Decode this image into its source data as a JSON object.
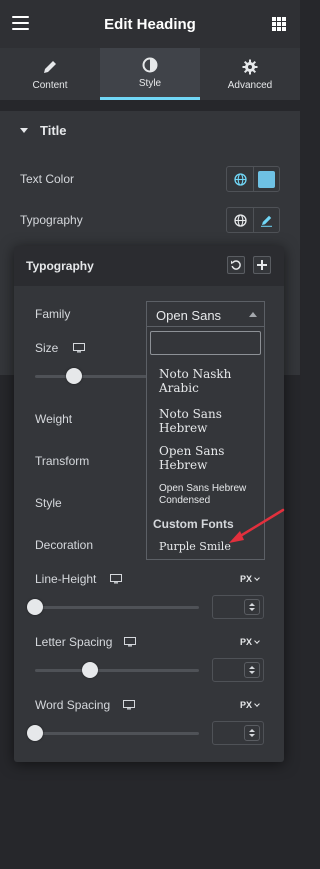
{
  "header": {
    "title": "Edit Heading"
  },
  "tabs": [
    {
      "label": "Content",
      "icon": "pencil-icon"
    },
    {
      "label": "Style",
      "icon": "contrast-icon"
    },
    {
      "label": "Advanced",
      "icon": "gear-icon"
    }
  ],
  "section": {
    "title": "Title"
  },
  "controls": {
    "text_color_label": "Text Color",
    "text_color_value": "#6ec1e4",
    "typography_label": "Typography"
  },
  "popover": {
    "title": "Typography",
    "family_label": "Family",
    "size_label": "Size",
    "weight_label": "Weight",
    "transform_label": "Transform",
    "style_label": "Style",
    "decoration_label": "Decoration",
    "line_height_label": "Line-Height",
    "line_height_unit": "PX",
    "letter_spacing_label": "Letter Spacing",
    "letter_spacing_unit": "PX",
    "word_spacing_label": "Word Spacing",
    "word_spacing_unit": "PX"
  },
  "family_select": {
    "selected": "Open Sans",
    "search_value": "",
    "options": [
      "Noto Naskh Arabic",
      "Noto Sans Hebrew",
      "Open Sans Hebrew",
      "Open Sans Hebrew Condensed"
    ],
    "group_label": "Custom Fonts",
    "custom_options": [
      "Purple Smile"
    ]
  },
  "colors": {
    "accent": "#71d7f7",
    "annotation_arrow": "#e2303d"
  }
}
